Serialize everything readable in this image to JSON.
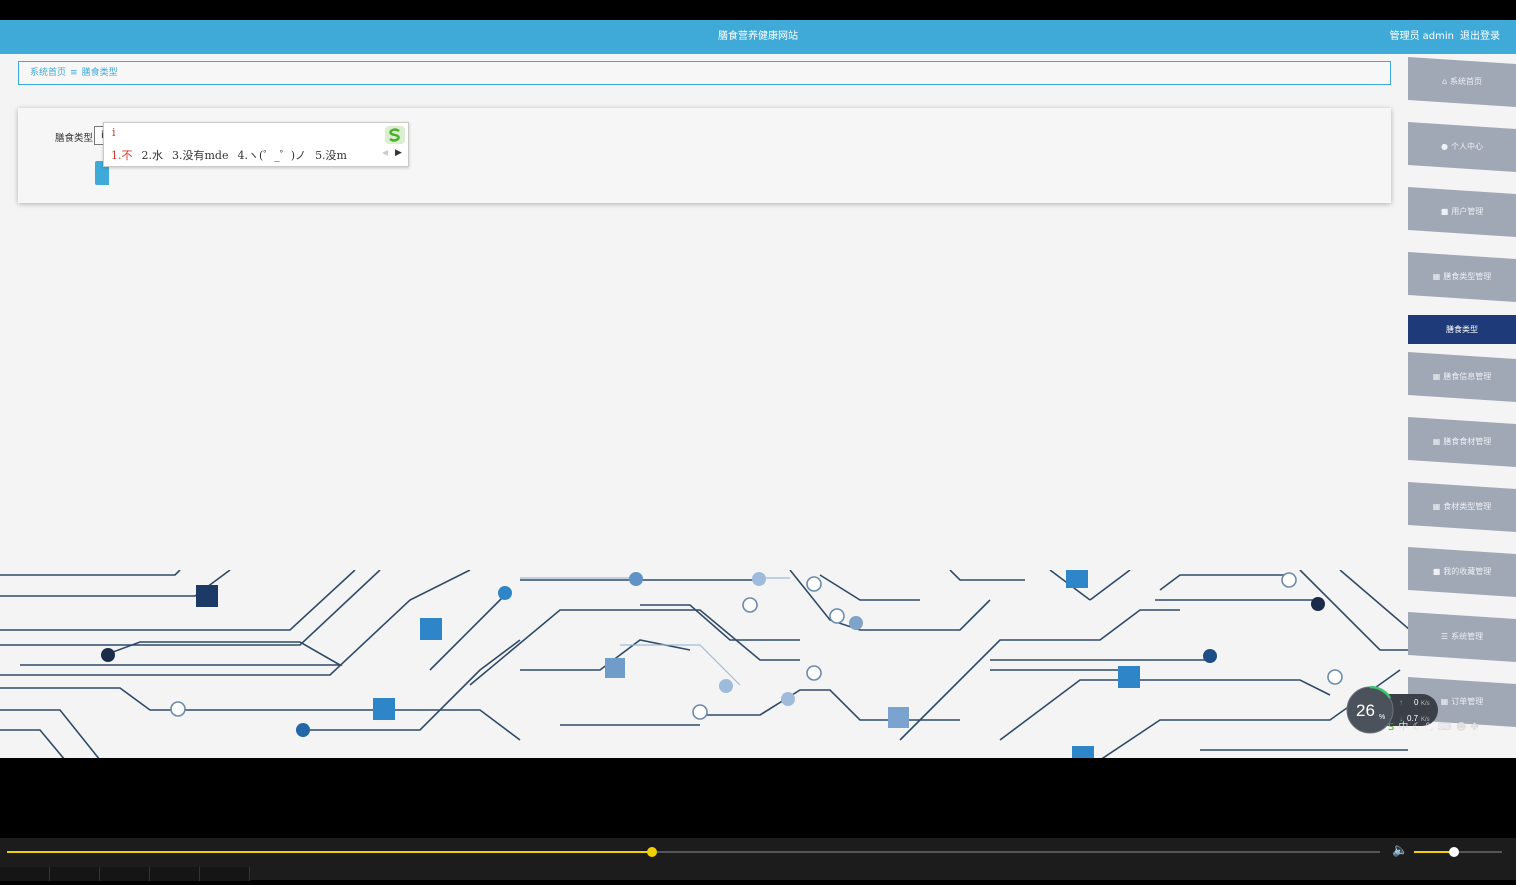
{
  "header": {
    "title": "膳食营养健康网站",
    "role": "管理员",
    "username": "admin",
    "logout": "退出登录"
  },
  "breadcrumb": {
    "home": "系统首页",
    "separator": "≡",
    "current": "膳食类型"
  },
  "form": {
    "label": "膳食类型",
    "input_value": "i"
  },
  "ime": {
    "composition": "i",
    "candidates": [
      "1.不",
      "2.水",
      "3.没有mde",
      "4.ヽ(゜_゜)ノ",
      "5.没m"
    ]
  },
  "sidebar": {
    "items": [
      {
        "label": "系统首页",
        "icon": "⌂"
      },
      {
        "label": "个人中心",
        "icon": "●"
      },
      {
        "label": "用户管理",
        "icon": "■"
      },
      {
        "label": "膳食类型管理",
        "icon": "▦"
      },
      {
        "label": "膳食类型",
        "icon": ""
      },
      {
        "label": "膳食信息管理",
        "icon": "▦"
      },
      {
        "label": "膳食食材管理",
        "icon": "▦"
      },
      {
        "label": "食材类型管理",
        "icon": "▦"
      },
      {
        "label": "我的收藏管理",
        "icon": "■"
      },
      {
        "label": "系统管理",
        "icon": "☰"
      },
      {
        "label": "订单管理",
        "icon": "▦"
      }
    ]
  },
  "net_widget": {
    "percent": "26",
    "percent_unit": "%",
    "upload": "0",
    "upload_unit": "K/s",
    "download": "0.7",
    "download_unit": "K/s"
  },
  "player": {
    "progress": 0.47,
    "volume": 0.45
  },
  "colors": {
    "header": "#3faad8",
    "sidebar_item": "#a0a7b5",
    "sidebar_active": "#1e3a78",
    "seek": "#f0d000"
  }
}
